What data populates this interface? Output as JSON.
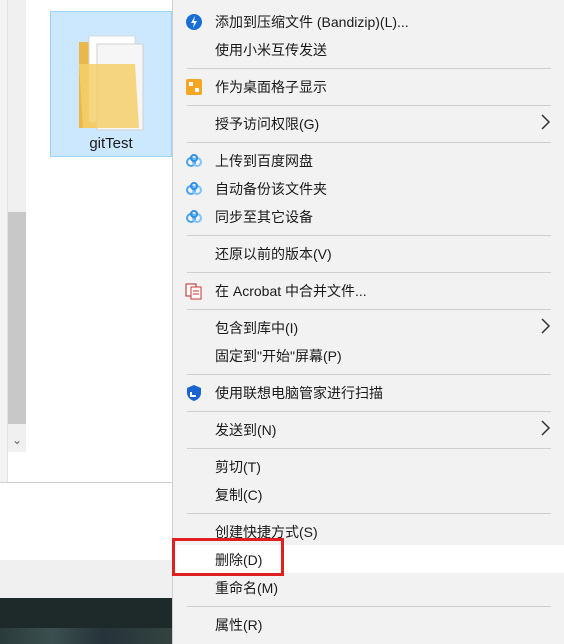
{
  "explorer": {
    "folder_name": "gitTest",
    "scroll_down_glyph": "⌄"
  },
  "context_menu": {
    "items": [
      {
        "label": "添加到压缩文件 (Bandizip)(L)...",
        "icon": "bandizip-icon"
      },
      {
        "label": "使用小米互传发送",
        "icon": ""
      },
      {
        "label": "作为桌面格子显示",
        "icon": "desktop-grid-icon"
      },
      {
        "label": "授予访问权限(G)",
        "icon": "",
        "submenu": true
      },
      {
        "label": "上传到百度网盘",
        "icon": "baidu-cloud-icon"
      },
      {
        "label": "自动备份该文件夹",
        "icon": "baidu-cloud-icon"
      },
      {
        "label": "同步至其它设备",
        "icon": "baidu-cloud-icon"
      },
      {
        "label": "还原以前的版本(V)",
        "icon": ""
      },
      {
        "label": "在 Acrobat 中合并文件...",
        "icon": "acrobat-icon"
      },
      {
        "label": "包含到库中(I)",
        "icon": "",
        "submenu": true
      },
      {
        "label": "固定到\"开始\"屏幕(P)",
        "icon": ""
      },
      {
        "label": "使用联想电脑管家进行扫描",
        "icon": "lenovo-shield-icon"
      },
      {
        "label": "发送到(N)",
        "icon": "",
        "submenu": true
      },
      {
        "label": "剪切(T)",
        "icon": ""
      },
      {
        "label": "复制(C)",
        "icon": ""
      },
      {
        "label": "创建快捷方式(S)",
        "icon": ""
      },
      {
        "label": "删除(D)",
        "icon": ""
      },
      {
        "label": "重命名(M)",
        "icon": ""
      },
      {
        "label": "属性(R)",
        "icon": ""
      }
    ]
  },
  "colors": {
    "highlight_outline": "#e02020",
    "selection_fill": "#cce8ff",
    "bandizip_blue": "#1a6fd6",
    "baidu_blue": "#4aa3f0"
  }
}
